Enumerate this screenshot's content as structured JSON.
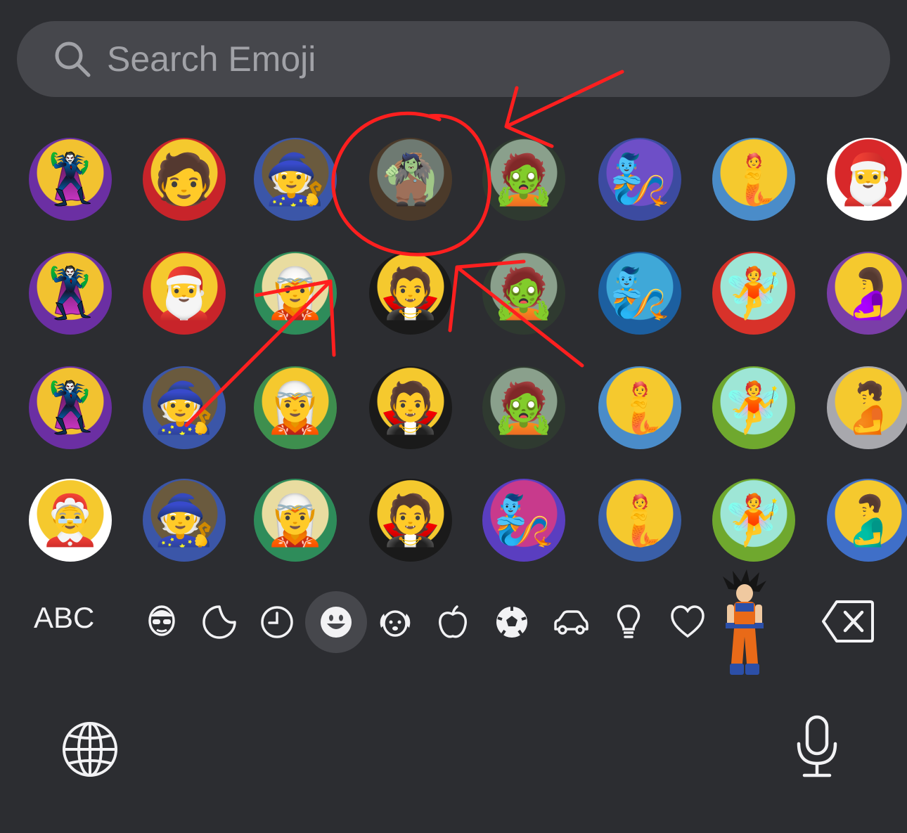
{
  "search": {
    "placeholder": "Search Emoji"
  },
  "grid": {
    "rows": [
      [
        {
          "name": "supervillain",
          "glyph": "🦹",
          "bg": "#f2c230",
          "accent": "#6b2fa3"
        },
        {
          "name": "mx-claus",
          "glyph": "🧑",
          "bg": "#f5c92e",
          "accent": "#c8242a"
        },
        {
          "name": "man-mage",
          "glyph": "🧙",
          "bg": "#6a5a3e",
          "accent": "#3b56a8"
        },
        {
          "name": "troll",
          "glyph": "🧌",
          "bg": "#6e7a72",
          "accent": "#4b3a2a"
        },
        {
          "name": "woman-zombie",
          "glyph": "🧟",
          "bg": "#8aa08c",
          "accent": "#2f3a30"
        },
        {
          "name": "woman-genie",
          "glyph": "🧞",
          "bg": "#6e4fc7",
          "accent": "#3c4ba0"
        },
        {
          "name": "merman",
          "glyph": "🧜",
          "bg": "#f5c92e",
          "accent": "#4a8cc9"
        },
        {
          "name": "santa-sleeping",
          "glyph": "🎅",
          "bg": "#d8282a",
          "accent": "#ffffff"
        }
      ],
      [
        {
          "name": "woman-supervillain",
          "glyph": "🦹",
          "bg": "#f2c230",
          "accent": "#6b2fa3"
        },
        {
          "name": "santa-claus",
          "glyph": "🎅",
          "bg": "#f5c92e",
          "accent": "#c8242a"
        },
        {
          "name": "woman-elf",
          "glyph": "🧝",
          "bg": "#e9dca0",
          "accent": "#2e8c5a"
        },
        {
          "name": "woman-vampire",
          "glyph": "🧛",
          "bg": "#f5c92e",
          "accent": "#1a1a1a"
        },
        {
          "name": "man-zombie",
          "glyph": "🧟",
          "bg": "#8aa08c",
          "accent": "#2f3a30"
        },
        {
          "name": "genie",
          "glyph": "🧞",
          "bg": "#3fa8d8",
          "accent": "#1c5fa0"
        },
        {
          "name": "woman-fairy",
          "glyph": "🧚",
          "bg": "#9ee6d6",
          "accent": "#d8322a"
        },
        {
          "name": "pregnant-woman",
          "glyph": "🤰",
          "bg": "#f5c92e",
          "accent": "#7a3ea8"
        }
      ],
      [
        {
          "name": "man-supervillain",
          "glyph": "🦹",
          "bg": "#f2c230",
          "accent": "#6b2fa3"
        },
        {
          "name": "woman-mage",
          "glyph": "🧙",
          "bg": "#6a5a3e",
          "accent": "#3b56a8"
        },
        {
          "name": "elf",
          "glyph": "🧝",
          "bg": "#f5c92e",
          "accent": "#3e8f4e"
        },
        {
          "name": "vampire",
          "glyph": "🧛",
          "bg": "#f5c92e",
          "accent": "#1a1a1a"
        },
        {
          "name": "zombie",
          "glyph": "🧟",
          "bg": "#8aa08c",
          "accent": "#2f3a30"
        },
        {
          "name": "mermaid",
          "glyph": "🧜",
          "bg": "#f5c92e",
          "accent": "#4a8cc9"
        },
        {
          "name": "fairy",
          "glyph": "🧚",
          "bg": "#9ee6d6",
          "accent": "#6fa82e"
        },
        {
          "name": "pregnant-person",
          "glyph": "🫄",
          "bg": "#f5c92e",
          "accent": "#a8a8ad"
        }
      ],
      [
        {
          "name": "mrs-claus",
          "glyph": "🤶",
          "bg": "#f5c92e",
          "accent": "#ffffff"
        },
        {
          "name": "mage",
          "glyph": "🧙",
          "bg": "#6a5a3e",
          "accent": "#3b56a8"
        },
        {
          "name": "man-elf",
          "glyph": "🧝",
          "bg": "#e9dca0",
          "accent": "#2e8c5a"
        },
        {
          "name": "man-vampire",
          "glyph": "🧛",
          "bg": "#f5c92e",
          "accent": "#1a1a1a"
        },
        {
          "name": "man-genie",
          "glyph": "🧞",
          "bg": "#c83a8c",
          "accent": "#5a3ec0"
        },
        {
          "name": "woman-mermaid",
          "glyph": "🧜",
          "bg": "#f5c92e",
          "accent": "#3a5fa8"
        },
        {
          "name": "man-fairy",
          "glyph": "🧚",
          "bg": "#9ee6d6",
          "accent": "#6fa82e"
        },
        {
          "name": "pregnant-man",
          "glyph": "🫃",
          "bg": "#f5c92e",
          "accent": "#3f6fc8"
        }
      ]
    ]
  },
  "keyboard": {
    "abc_label": "ABC",
    "categories": [
      {
        "name": "memoji",
        "icon": "memoji-icon"
      },
      {
        "name": "stickers",
        "icon": "sticker-icon"
      },
      {
        "name": "recent",
        "icon": "clock-icon"
      },
      {
        "name": "smileys",
        "icon": "smiley-icon",
        "selected": true
      },
      {
        "name": "animals",
        "icon": "dog-icon"
      },
      {
        "name": "food",
        "icon": "apple-icon"
      },
      {
        "name": "activity",
        "icon": "soccer-ball-icon"
      },
      {
        "name": "travel",
        "icon": "car-icon"
      },
      {
        "name": "objects",
        "icon": "lightbulb-icon"
      },
      {
        "name": "symbols",
        "icon": "heart-icon"
      }
    ]
  },
  "colors": {
    "background": "#2c2d31",
    "search_bg": "#46474c",
    "placeholder": "#a1a2a7",
    "annotation": "#ff1f1f",
    "icon": "#f2f2f4"
  }
}
